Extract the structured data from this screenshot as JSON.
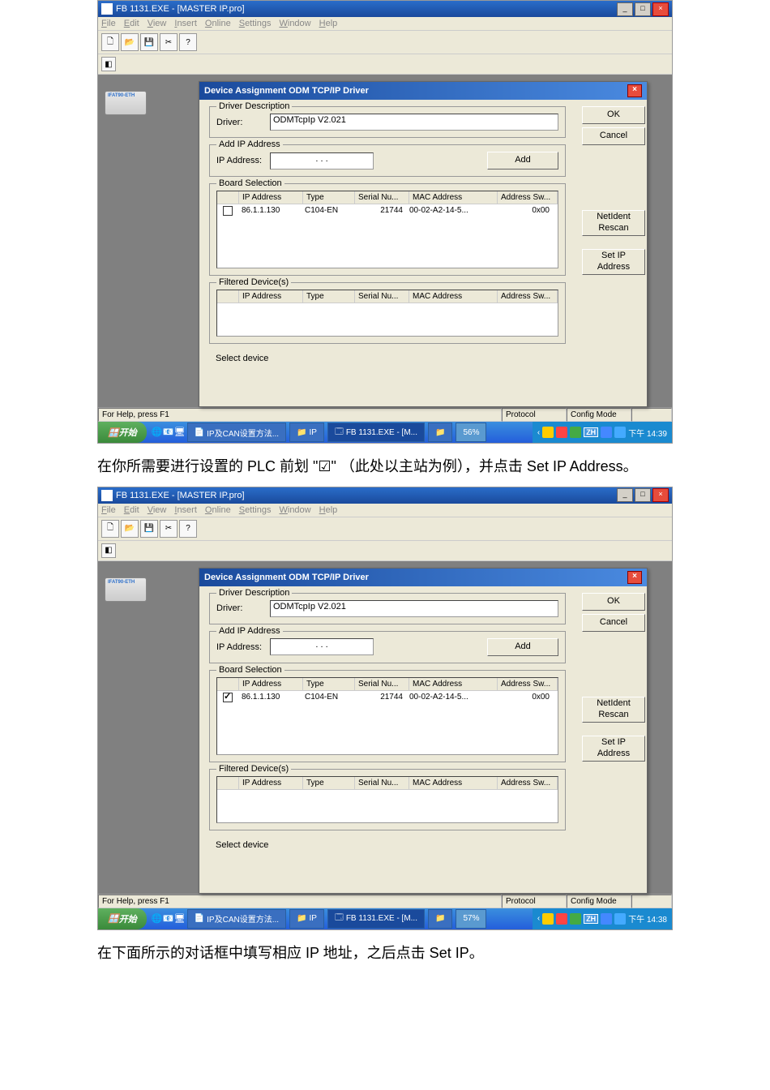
{
  "instruction1": "在你所需要进行设置的 PLC 前划 \"☑\" （此处以主站为例），并点击 Set IP Address。",
  "instruction2": "在下面所示的对话框中填写相应 IP 地址，之后点击 Set IP。",
  "window": {
    "title": "FB 1131.EXE - [MASTER IP.pro]",
    "menu": [
      "File",
      "Edit",
      "View",
      "Insert",
      "Online",
      "Settings",
      "Window",
      "Help"
    ]
  },
  "dialog": {
    "title": "Device Assignment ODM TCP/IP Driver",
    "grp_driver": "Driver Description",
    "driver_label": "Driver:",
    "driver_value": "ODMTcpIp V2.021",
    "grp_addip": "Add IP Address",
    "ip_label": "IP Address:",
    "ip_value": ".   .   .",
    "add_btn": "Add",
    "grp_board": "Board Selection",
    "cols": {
      "ip": "IP Address",
      "type": "Type",
      "serial": "Serial Nu...",
      "mac": "MAC Address",
      "addr": "Address Sw..."
    },
    "row": {
      "ip": "86.1.1.130",
      "type": "C104-EN",
      "serial": "21744",
      "mac": "00-02-A2-14-5...",
      "addr": "0x00"
    },
    "grp_filtered": "Filtered Device(s)",
    "status": "Select device",
    "btns": {
      "ok": "OK",
      "cancel": "Cancel",
      "netident": "NetIdent Rescan",
      "setip": "Set IP Address"
    }
  },
  "statusbar": {
    "help": "For Help, press F1",
    "protocol": "Protocol",
    "mode": "Config Mode"
  },
  "taskbar": {
    "start": "开始",
    "items": [
      "IP及CAN设置方法...",
      "IP",
      "FB 1131.EXE - [M..."
    ],
    "percent1": "56%",
    "percent2": "57%",
    "time1": "下午 14:39",
    "time2": "下午 14:38",
    "lang": "ZH"
  }
}
